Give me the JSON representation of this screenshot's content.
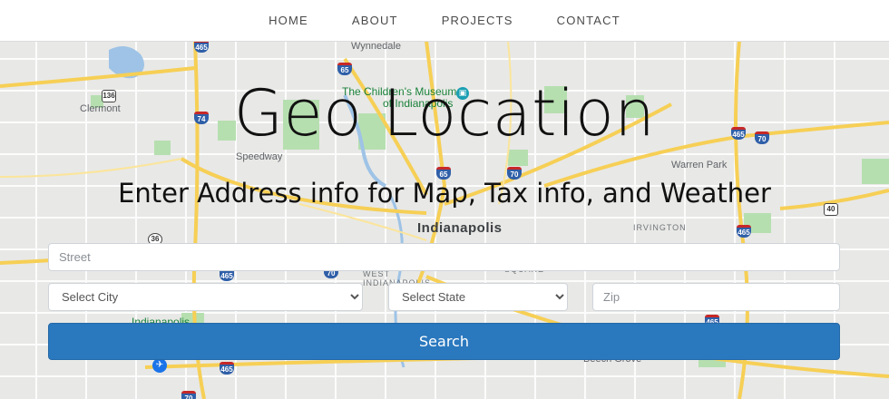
{
  "nav": {
    "items": [
      "HOME",
      "ABOUT",
      "PROJECTS",
      "CONTACT"
    ]
  },
  "hero": {
    "title": "Geo Location",
    "subtitle": "Enter Address info for Map, Tax info, and Weather"
  },
  "form": {
    "street_placeholder": "Street",
    "city_selected": "Select City",
    "state_selected": "Select State",
    "zip_placeholder": "Zip",
    "search_label": "Search"
  },
  "map": {
    "labels": {
      "wynnedale": "Wynnedale",
      "museum_line1": "The Children's Museum",
      "museum_line2": "of Indianapolis",
      "clermont": "Clermont",
      "speedway": "Speedway",
      "indianapolis": "Indianapolis",
      "irvington": "IRVINGTON",
      "warren_park": "Warren Park",
      "west_indianapolis": "WEST INDIANAPOLIS",
      "square": "SQUARE",
      "beech_grove": "Beech Grove",
      "airport": "Indianapolis"
    },
    "shields": {
      "i465_nw": "465",
      "i65_n": "65",
      "i136": "136",
      "i74": "74",
      "i465_ne": "465",
      "i70_ne": "70",
      "i65_c": "65",
      "i70_c": "70",
      "us40": "40",
      "i465_e": "465",
      "i36": "36",
      "i465_w": "465",
      "i70_sw": "70",
      "i465_s": "465",
      "i70_s": "70",
      "i465_se": "465"
    },
    "colors": {
      "road": "#f6cf55",
      "park": "#b6dfb0",
      "water": "#9ec3e6",
      "base": "#e8e8e6"
    }
  }
}
